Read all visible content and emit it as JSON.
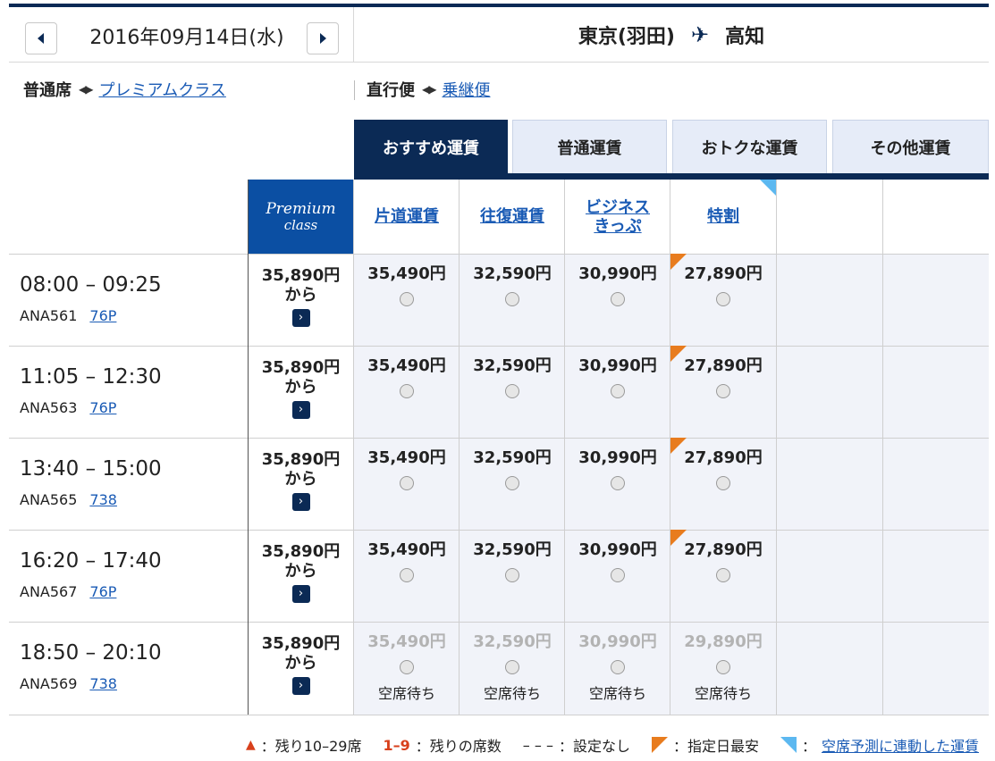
{
  "header": {
    "date": "2016年09月14日(水)",
    "origin": "東京(羽田)",
    "destination": "高知"
  },
  "toggles": {
    "cabin_current": "普通席",
    "cabin_link": "プレミアムクラス",
    "route_current": "直行便",
    "route_link": "乗継便"
  },
  "tabs": [
    "おすすめ運賃",
    "普通運賃",
    "おトクな運賃",
    "その他運賃"
  ],
  "premium_label": {
    "line1": "Premium",
    "line2": "class"
  },
  "fare_headers": [
    "片道運賃",
    "往復運賃",
    "ビジネス\nきっぷ",
    "特割"
  ],
  "flights": [
    {
      "time": "08:00 – 09:25",
      "number": "ANA561",
      "aircraft": "76P",
      "premium": "35,890円",
      "premium_from": "から",
      "fares": [
        "35,490円",
        "32,590円",
        "30,990円",
        "27,890円"
      ],
      "waitlist": false
    },
    {
      "time": "11:05 – 12:30",
      "number": "ANA563",
      "aircraft": "76P",
      "premium": "35,890円",
      "premium_from": "から",
      "fares": [
        "35,490円",
        "32,590円",
        "30,990円",
        "27,890円"
      ],
      "waitlist": false
    },
    {
      "time": "13:40 – 15:00",
      "number": "ANA565",
      "aircraft": "738",
      "premium": "35,890円",
      "premium_from": "から",
      "fares": [
        "35,490円",
        "32,590円",
        "30,990円",
        "27,890円"
      ],
      "waitlist": false
    },
    {
      "time": "16:20 – 17:40",
      "number": "ANA567",
      "aircraft": "76P",
      "premium": "35,890円",
      "premium_from": "から",
      "fares": [
        "35,490円",
        "32,590円",
        "30,990円",
        "27,890円"
      ],
      "waitlist": false
    },
    {
      "time": "18:50 – 20:10",
      "number": "ANA569",
      "aircraft": "738",
      "premium": "35,890円",
      "premium_from": "から",
      "fares": [
        "35,490円",
        "32,590円",
        "30,990円",
        "29,890円"
      ],
      "waitlist": true
    }
  ],
  "waitlist_label": "空席待ち",
  "legend": {
    "remaining_range": "：残り10–29席",
    "seat_count_key": "1–9",
    "seat_count_label": "：残りの席数",
    "none_key": "– – –",
    "none_label": "：設定なし",
    "lowest_label": "：指定日最安",
    "linked_label": "：",
    "linked_link": "空席予測に連動した運賃"
  },
  "colors": {
    "navy": "#0b2a55",
    "premium_blue": "#0b4fa3",
    "link": "#1a5bb5",
    "orange": "#e87c1e",
    "light_blue": "#5cb8f0"
  }
}
